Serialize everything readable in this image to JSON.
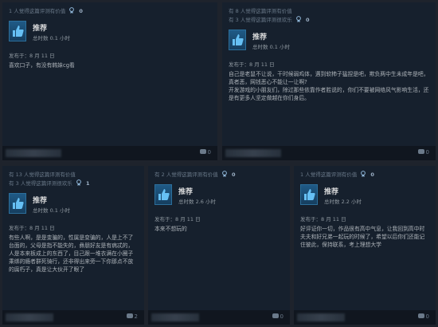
{
  "cards": [
    {
      "helpful": "1 人觉得这篇评测有价值",
      "funny": "",
      "award_count": "0",
      "rec": "推荐",
      "hours": "总时数 0.1 小时",
      "posted": "发布于：8 月 11 日",
      "body": "喜欢口子，有没有韩妹cg看",
      "comments": "0"
    },
    {
      "helpful": "有 8 人觉得这篇评测有价值",
      "funny": "有 3 人觉得这篇评测很欢乐",
      "award_count": "0",
      "rec": "推荐",
      "hours": "总时数 0.1 小时",
      "posted": "发布于：8 月 11 日",
      "body": "自己是老鼠不让说，干时候弱鸡体，遇到软柿子猛捏是吧，欺负两中生未成年是吧，真者恶，网钱恶心不能让一让啊?\n开发游戏的小朋友们，除过那些依靠作者胜说的，你们不要被网络风气影响生活，还是有更多人坚定做越在你们身后。",
      "comments": "0"
    },
    {
      "helpful": "有 13 人觉得这篇评测有价值",
      "funny": "有 3 人觉得这篇评测很欢乐",
      "award_count": "1",
      "rec": "推荐",
      "hours": "总时数 0.1 小时",
      "posted": "发布于：8 月 11 日",
      "body": "有些人啊，是是变骗的，性属是变骗的，人是上不了台面的，父母是指不能失的，彝朋好友是有病忒的，人是本来板成上的东西了，目己跟一堆衣满在小圈子乘绑的瘾者群死骑行，还非得出来旁一下你那点不放的腐朽子，真是让大伙开了眼了",
      "comments": "2"
    },
    {
      "helpful": "有 2 人觉得这篇评测有价值",
      "funny": "",
      "award_count": "0",
      "rec": "推荐",
      "hours": "总时数 2.6 小时",
      "posted": "发布于：8 月 11 日",
      "body": "本来不想玩的",
      "comments": "0"
    },
    {
      "helpful": "1 人觉得这篇评测有价值",
      "funny": "",
      "award_count": "0",
      "rec": "推荐",
      "hours": "总时数 2.2 小时",
      "posted": "发布于：8 月 11 日",
      "body": "好评证你一切，作品很有高中气息，让我回到高中时夫夫和好兄弟一起玩的时候了，希望以后你们还能记住彼此，保持联系，考上理想大学",
      "comments": "0"
    }
  ]
}
